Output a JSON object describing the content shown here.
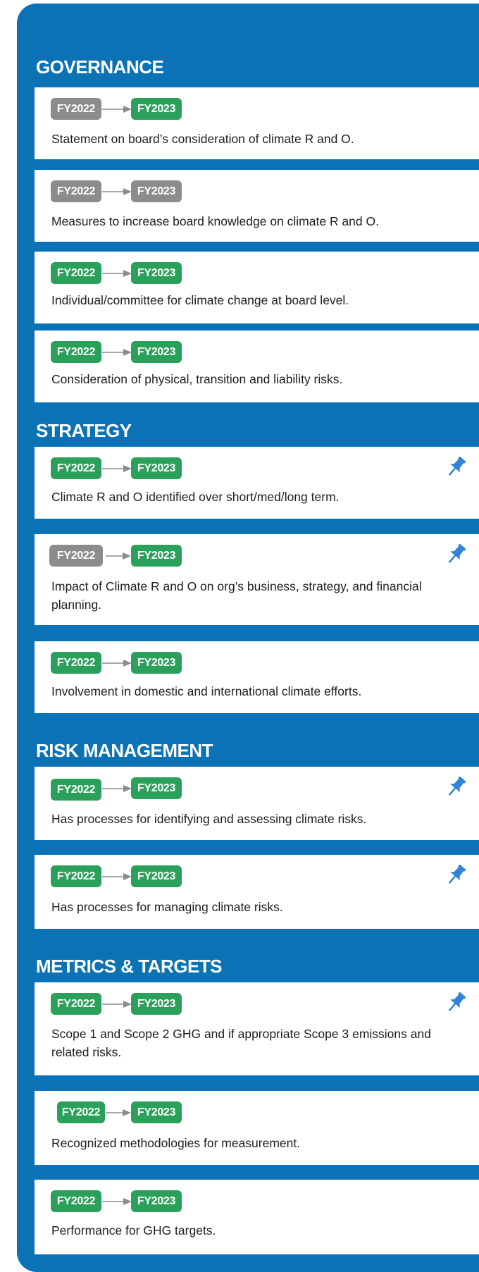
{
  "colors": {
    "panel": "#0b72b5",
    "active": "#2aa05a",
    "inactive": "#8c8c8e",
    "pin": "#2f82d6"
  },
  "sections": {
    "governance": {
      "title": "GOVERNANCE",
      "items": [
        {
          "from": "FY2022",
          "to": "FY2023",
          "from_status": "inactive",
          "to_status": "active",
          "text": "Statement on board’s consideration of climate R and O.",
          "pinned": false
        },
        {
          "from": "FY2022",
          "to": "FY2023",
          "from_status": "inactive",
          "to_status": "inactive",
          "text": "Measures to increase board knowledge on climate R and O.",
          "pinned": false
        },
        {
          "from": "FY2022",
          "to": "FY2023",
          "from_status": "active",
          "to_status": "active",
          "text": "Individual/committee for climate change at board level.",
          "pinned": false
        },
        {
          "from": "FY2022",
          "to": "FY2023",
          "from_status": "active",
          "to_status": "active",
          "text": "Consideration of physical, transition and liability risks.",
          "pinned": false
        }
      ]
    },
    "strategy": {
      "title": "STRATEGY",
      "items": [
        {
          "from": "FY2022",
          "to": "FY2023",
          "from_status": "active",
          "to_status": "active",
          "text": "Climate R and O identified over short/med/long term.",
          "pinned": true,
          "pin_icon": "pushpin-icon"
        },
        {
          "from": "FY2022",
          "to": "FY2023",
          "from_status": "inactive",
          "to_status": "active",
          "text": "Impact of Climate R and O on org’s business, strategy, and financial planning.",
          "pinned": true,
          "pin_icon": "pushpin-icon"
        },
        {
          "from": "FY2022",
          "to": "FY2023",
          "from_status": "active",
          "to_status": "active",
          "text": "Involvement in domestic and international climate efforts.",
          "pinned": false
        }
      ]
    },
    "risk_management": {
      "title": "RISK MANAGEMENT",
      "items": [
        {
          "from": "FY2022",
          "to": "FY2023",
          "from_status": "active",
          "to_status": "active",
          "text": "Has processes for identifying and assessing climate risks.",
          "pinned": true,
          "pin_icon": "pushpin-icon"
        },
        {
          "from": "FY2022",
          "to": "FY2023",
          "from_status": "active",
          "to_status": "active",
          "text": "Has processes for managing climate risks.",
          "pinned": true,
          "pin_icon": "pushpin-icon"
        }
      ]
    },
    "metrics_targets": {
      "title": "METRICS & TARGETS",
      "items": [
        {
          "from": "FY2022",
          "to": "FY2023",
          "from_status": "active",
          "to_status": "active",
          "text": "Scope 1 and Scope 2 GHG and if appropriate Scope 3 emissions and related risks.",
          "pinned": true,
          "pin_icon": "pushpin-icon"
        },
        {
          "from": "FY2022",
          "to": "FY2023",
          "from_status": "active",
          "to_status": "active",
          "text": "Recognized methodologies for measurement.",
          "pinned": false
        },
        {
          "from": "FY2022",
          "to": "FY2023",
          "from_status": "active",
          "to_status": "active",
          "text": "Performance for GHG targets.",
          "pinned": false
        }
      ]
    }
  }
}
